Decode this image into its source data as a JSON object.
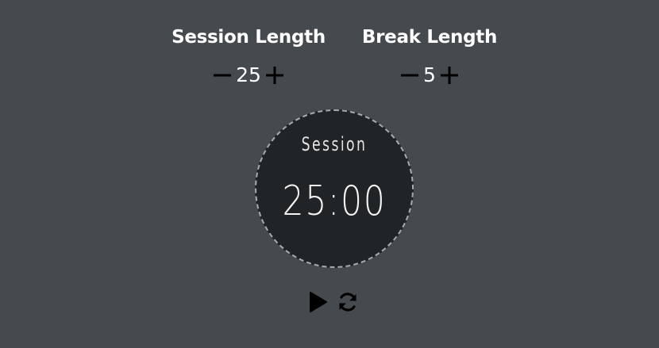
{
  "session": {
    "title": "Session Length",
    "value": "25",
    "decrement_icon": "minus-icon",
    "increment_icon": "plus-icon"
  },
  "break": {
    "title": "Break Length",
    "value": "5",
    "decrement_icon": "minus-icon",
    "increment_icon": "plus-icon"
  },
  "timer": {
    "label": "Session",
    "time": "25:00"
  },
  "controls": {
    "play_icon": "play-icon",
    "reset_icon": "refresh-icon"
  },
  "colors": {
    "background": "#454a4e",
    "timer_face": "#212427",
    "text": "#ffffff",
    "icon": "#000000"
  }
}
